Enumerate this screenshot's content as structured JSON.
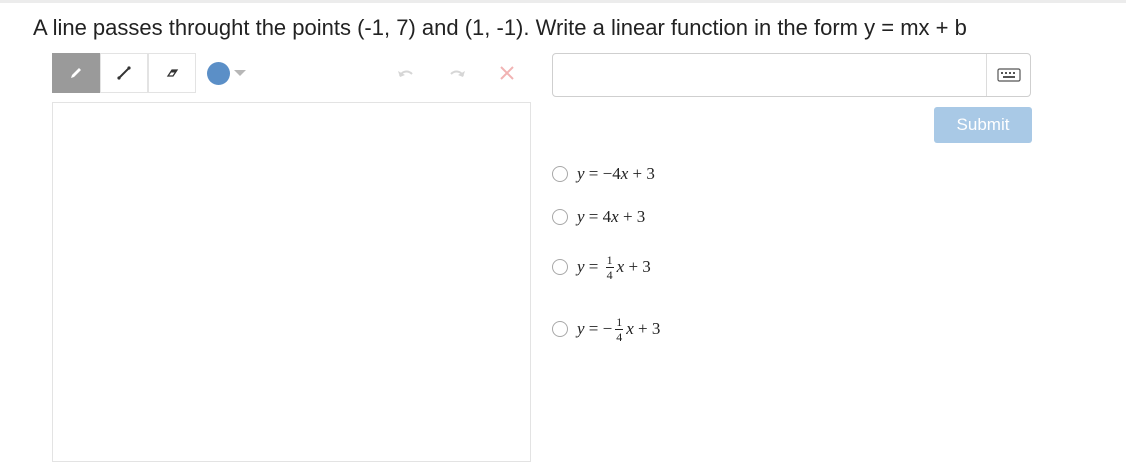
{
  "question": {
    "text": "A line passes throught the points (-1, 7) and (1, -1). Write a linear function in the form y = mx + b"
  },
  "toolbar": {
    "tools": [
      "pencil-icon",
      "line-icon",
      "eraser-icon"
    ],
    "active_tool": "pencil-icon",
    "color": "#5b8fc7",
    "undo_icon": "undo-icon",
    "redo_icon": "redo-icon",
    "clear_icon": "close-icon"
  },
  "answer_input": {
    "value": "",
    "placeholder": "",
    "keyboard_icon": "keyboard-icon"
  },
  "submit": {
    "label": "Submit",
    "color": "#a9c9e6"
  },
  "choices": [
    {
      "lhs": "y",
      "eq": " = ",
      "coef": "−4",
      "var": "x",
      "tail": " + 3"
    },
    {
      "lhs": "y",
      "eq": " = ",
      "coef": "4",
      "var": "x",
      "tail": " + 3"
    },
    {
      "lhs": "y",
      "eq": " = ",
      "sign": "",
      "num": "1",
      "den": "4",
      "var": "x",
      "tail": " + 3"
    },
    {
      "lhs": "y",
      "eq": " = ",
      "sign": "−",
      "num": "1",
      "den": "4",
      "var": "x",
      "tail": " + 3"
    }
  ]
}
